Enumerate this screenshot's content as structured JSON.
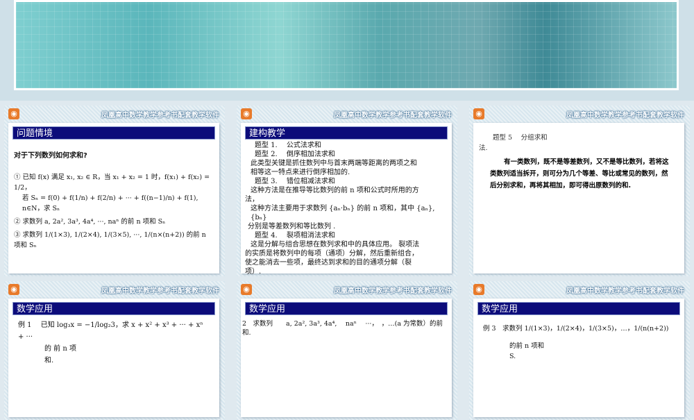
{
  "brand": "凤凰高中数学教学参考书配套教学软件",
  "slides": [
    {
      "title": "问题情境",
      "lead": "对于下列数列如何求和?",
      "lines": [
        "① 已知 f(x) 满足 x₁, x₂ ∈ R，当 x₁ + x₂ = 1 时，f(x₁) + f(x₂) = 1/2，",
        "若 Sₙ = f(0) + f(1/n) + f(2/n) + ··· + f((n−1)/n) + f(1), n∈N，求 Sₙ",
        "② 求数列 a, 2a², 3a³, 4a⁴, ···, naⁿ  的前 n 项和  Sₙ",
        "③ 求数列 1/(1×3), 1/(2×4), 1/(3×5), ···, 1/(n×(n+2))  的前 n 项和  Sₙ"
      ]
    },
    {
      "title": "建构教学",
      "lines": [
        "题型 1.　 公式法求和",
        "题型 2.　 倒序相加法求和",
        "此类型关键是抓住数列中与首末两端等距离的两项之和",
        "相等这一特点来进行倒序相加的.",
        "题型 3.　 错位相减法求和",
        "这种方法是在推导等比数列的前 n 项和公式时所用的方",
        "法，",
        "这种方法主要用于求数列 {aₙ·bₙ} 的前 n 项和，其中 {aₙ},{bₙ}",
        "分别是等差数列和等比数列 .",
        "题型 4.　 裂项相消法求和",
        "这是分解与组合思想在数列求和中的具体应用。 裂项法",
        "的实质是将数列中的每项（通项）分解，然后重新组合，",
        "使之能消去一些项，最终达到求和的目的通项分解（裂",
        "项）."
      ]
    },
    {
      "lines": [
        "题型 5　 分组求和",
        "法."
      ],
      "para": "有一类数列，既不是等差数列，又不是等比数列，若将这类数列适当拆开，则可分为几个等差、等比或常见的数列，然后分别求和，再将其相加，即可得出原数列的和."
    },
    {
      "title": "数学应用",
      "lines": [
        "例 1　 已知 log₃x = −1/log₂3，求 x + x² + x³ + ··· + xⁿ + ···",
        "的 前 n 项",
        "和."
      ]
    },
    {
      "title": "数学应用",
      "lines": [
        "2　求数列　　a, 2a², 3a³, 4a⁴,　 naⁿ　 ···，　，…(a 为常数）的前",
        "和."
      ]
    },
    {
      "title": "数学应用",
      "lines": [
        "例 3　求数列 1/(1×3)，1/(2×4)，1/(3×5)，…，1/(n(n+2))",
        "的前 n 项和",
        "S."
      ]
    }
  ]
}
